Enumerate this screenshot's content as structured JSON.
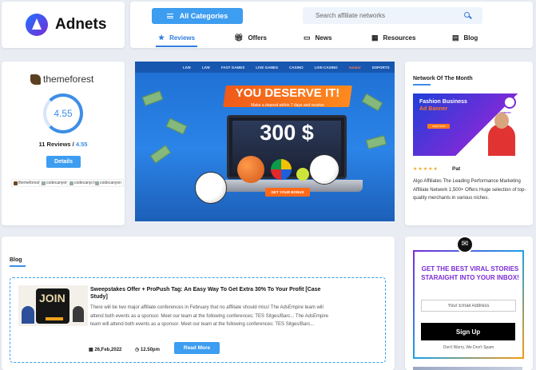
{
  "header": {
    "logo_text": "Adnets",
    "categories_label": "All Categories",
    "search_placeholder": "Search affiliate networks",
    "nav": [
      {
        "label": "Reviews",
        "icon": "star-icon"
      },
      {
        "label": "Offers",
        "icon": "gift-icon"
      },
      {
        "label": "News",
        "icon": "news-icon"
      },
      {
        "label": "Resources",
        "icon": "resources-icon"
      },
      {
        "label": "Blog",
        "icon": "document-icon"
      }
    ],
    "accent": "#3d9df0"
  },
  "rating": {
    "brand": "themeforest",
    "score": "4.55",
    "reviews_count": "11 Reviews",
    "reviews_sep": " / ",
    "reviews_score": "4.55",
    "details_label": "Details",
    "mini_logos": [
      "themeforest",
      "codecanyon",
      "codecanyon",
      "codecanyon"
    ]
  },
  "banner": {
    "nav_items": [
      "LIVE",
      "LIVE",
      "FAST GAMES",
      "LIVE GAMES",
      "CASINO",
      "LIVE-CASINO",
      "Aviator",
      "ESPORTS"
    ],
    "headline": "YOU DESERVE IT!",
    "subline": "Make a deposit within 7 days and receive",
    "amount": "300 $",
    "cta": "GET YOUR BONUS"
  },
  "network": {
    "title": "Network Of The Month",
    "ad_line1": "Fashion Business",
    "ad_line2": "Ad Banner",
    "ad_button": "SHOP NOW",
    "ad_brand": "COMPANY",
    "stars": "★★★★★",
    "author": "Pat",
    "description": "Algo Affiliates The Leading Performance Marketing Affiliate Network 1,500+ Offers Huge selection of top-quality merchants in various niches."
  },
  "blog": {
    "section_title": "Blog",
    "thumb_text": "JOIN",
    "post_title": "Sweepstakes Offer + ProPush Tag: An Easy Way To Get Extra 30% To Your Profit [Case Study]",
    "excerpt": "There will be two major affiliate conferences in February that no affiliate should miss! The AdsEmpire team will attend both events as a sponsor. Meet our team at the following conferences: TES Sitges/Barc... The AdsEmpire team will attend both events as a sponsor. Meet our team at the following conferences: TES Sitges/Barc...",
    "date": "26,Feb,2022",
    "time": "12.50pm",
    "read_more": "Read More"
  },
  "newsletter": {
    "title": "GET THE BEST VIRAL STORIES STARAIGHT INTO YOUR INBOX!",
    "email_placeholder": "Your Email Address",
    "signup_label": "Sign Up",
    "note": "Don't Worry, We Don't Spam"
  }
}
